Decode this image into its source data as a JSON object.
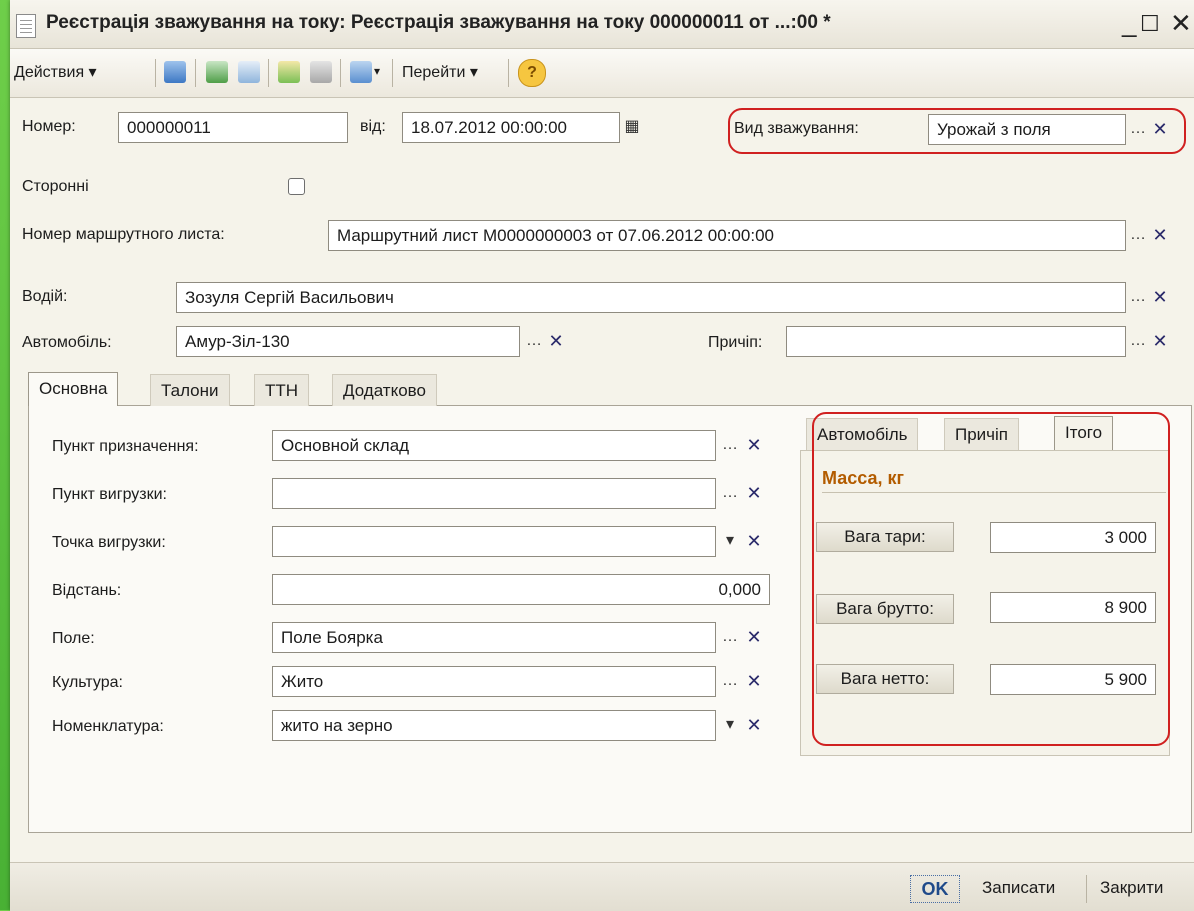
{
  "window": {
    "title": "Реєстрація зважування на току: Реєстрація зважування на току 000000011 от ...:00 *",
    "minimize": "_",
    "maximize": "☐",
    "close": "✕"
  },
  "toolbar": {
    "actions_label": "Действия ▾",
    "goto_label": "Перейти ▾",
    "help_label": "?"
  },
  "header": {
    "number_label": "Номер:",
    "number_value": "000000011",
    "date_label": "від:",
    "date_value": "18.07.2012 00:00:00",
    "weighing_type_label": "Вид зважування:",
    "weighing_type_value": "Урожай з поля",
    "external_label": "Сторонні",
    "route_sheet_label": "Номер маршрутного листа:",
    "route_sheet_value": "Маршрутний лист М0000000003 от 07.06.2012 00:00:00",
    "driver_label": "Водій:",
    "driver_value": "Зозуля Сергій Васильович",
    "car_label": "Автомобіль:",
    "car_value": "Амур-Зіл-130",
    "trailer_label": "Причіп:",
    "trailer_value": ""
  },
  "tabs": [
    "Основна",
    "Талони",
    "ТТН",
    "Додатково"
  ],
  "main_tab": {
    "destination_label": "Пункт призначення:",
    "destination_value": "Основной склад",
    "unload_point_label": "Пункт вигрузки:",
    "unload_point_value": "",
    "unload_spot_label": "Точка вигрузки:",
    "unload_spot_value": "",
    "distance_label": "Відстань:",
    "distance_value": "0,000",
    "field_label": "Поле:",
    "field_value": "Поле Боярка",
    "crop_label": "Культура:",
    "crop_value": "Жито",
    "nomenclature_label": "Номенклатура:",
    "nomenclature_value": "жито на зерно"
  },
  "sub_tabs": [
    "Автомобіль",
    "Причіп",
    "Ітого"
  ],
  "mass": {
    "title": "Масса, кг",
    "tare_label": "Вага тари:",
    "tare_value": "3 000",
    "gross_label": "Вага брутто:",
    "gross_value": "8 900",
    "net_label": "Вага нетто:",
    "net_value": "5 900"
  },
  "footer": {
    "ok_label": "OK",
    "save_label": "Записати",
    "close_label": "Закрити"
  },
  "colors": {
    "highlight": "#d02020",
    "mass_title": "#b35c00",
    "background": "#f5f3ea"
  }
}
